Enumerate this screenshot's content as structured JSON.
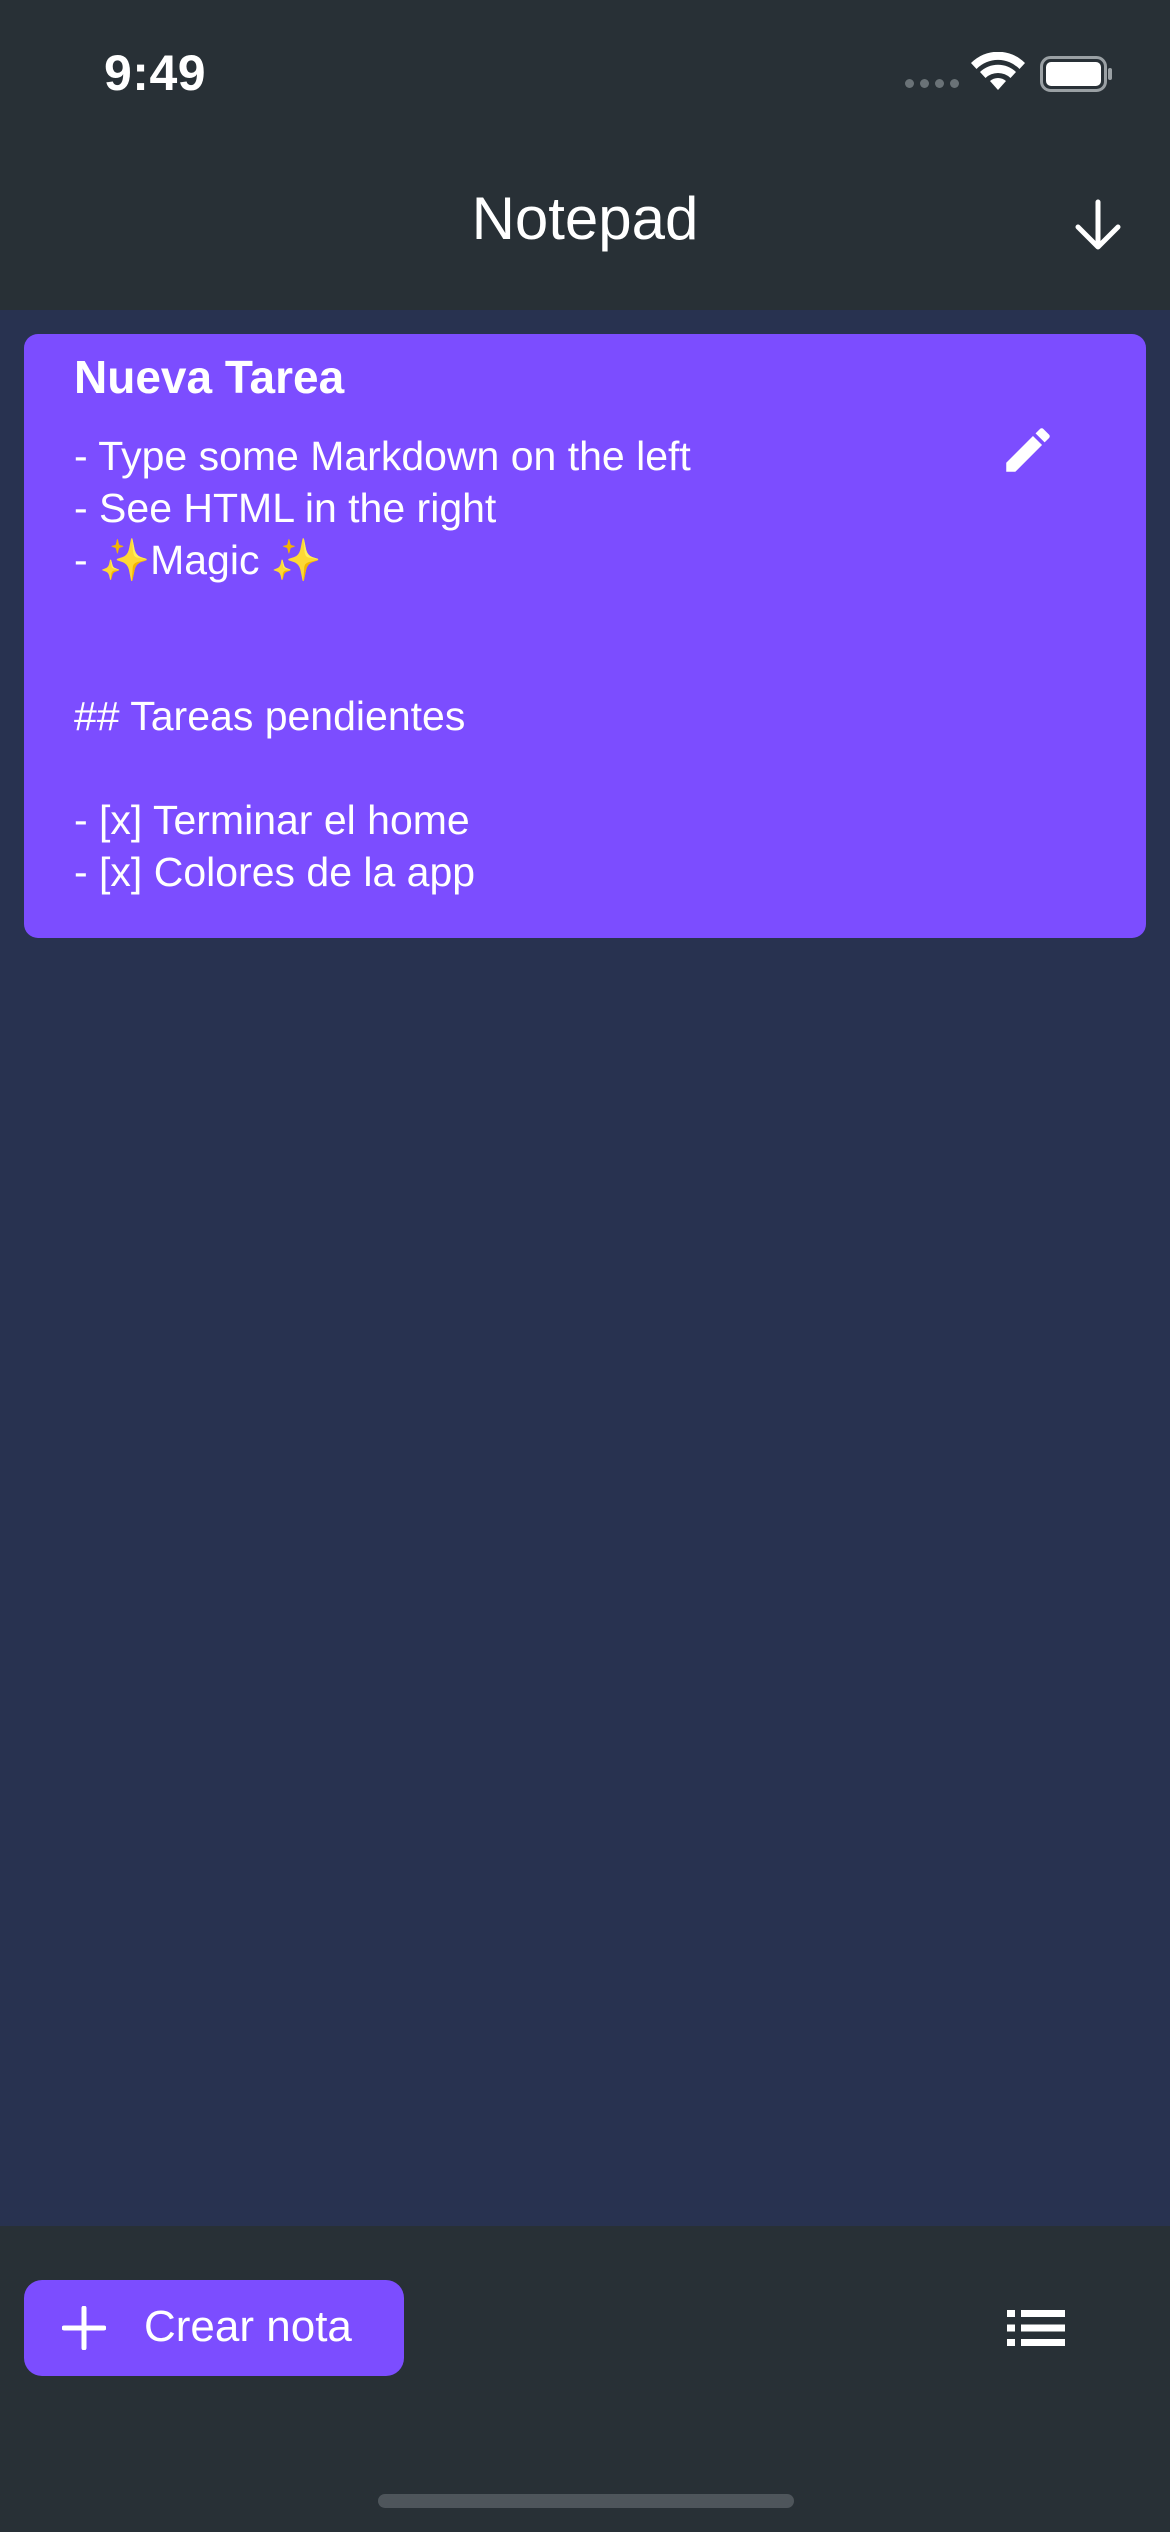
{
  "status_bar": {
    "time": "9:49"
  },
  "app_bar": {
    "title": "Notepad",
    "action_icon": "arrow-down-icon"
  },
  "notes": [
    {
      "title": "Nueva Tarea",
      "body": "- Type some Markdown on the left\n- See HTML in the right\n- ✨Magic ✨\n\n\n## Tareas pendientes\n\n- [x] Terminar el home\n- [x] Colores de la app",
      "action_icon": "pencil-icon"
    }
  ],
  "bottom_bar": {
    "create_label": "Crear nota",
    "create_icon": "plus-icon",
    "list_icon": "list-icon"
  },
  "colors": {
    "accent": "#7c4dff",
    "bar_background": "#283036",
    "content_background": "#283250",
    "text": "#ffffff"
  }
}
